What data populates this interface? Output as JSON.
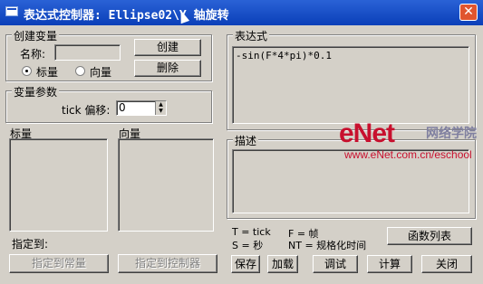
{
  "window": {
    "title": "表达式控制器: Ellipse02\\Y 轴旋转",
    "close_symbol": "✕"
  },
  "create_var": {
    "legend": "创建变量",
    "name_label": "名称:",
    "name_value": "",
    "create_button": "创建",
    "delete_button": "删除",
    "radio_scalar": "标量",
    "radio_vector": "向量",
    "selected": "标量"
  },
  "var_params": {
    "legend": "变量参数",
    "tick_label": "tick 偏移:",
    "tick_value": "0"
  },
  "lists": {
    "scalar_title": "标量",
    "vector_title": "向量"
  },
  "assign": {
    "label": "指定到:",
    "to_const_button": "指定到常量",
    "to_controller_button": "指定到控制器"
  },
  "expression": {
    "legend": "表达式",
    "text": "-sin(F*4*pi)*0.1"
  },
  "description": {
    "legend": "描述",
    "text": ""
  },
  "legend_text": {
    "line1_left": "T = tick",
    "line1_right": "F = 帧",
    "line2_left": "S = 秒",
    "line2_right": "NT = 规格化时间"
  },
  "buttons": {
    "function_list": "函数列表",
    "save": "保存",
    "load": "加载",
    "debug": "调试",
    "calculate": "计算",
    "close": "关闭"
  },
  "watermark": {
    "logo": "eNet",
    "cn": "网络学院",
    "url": "www.eNet.com.cn/eschool"
  }
}
